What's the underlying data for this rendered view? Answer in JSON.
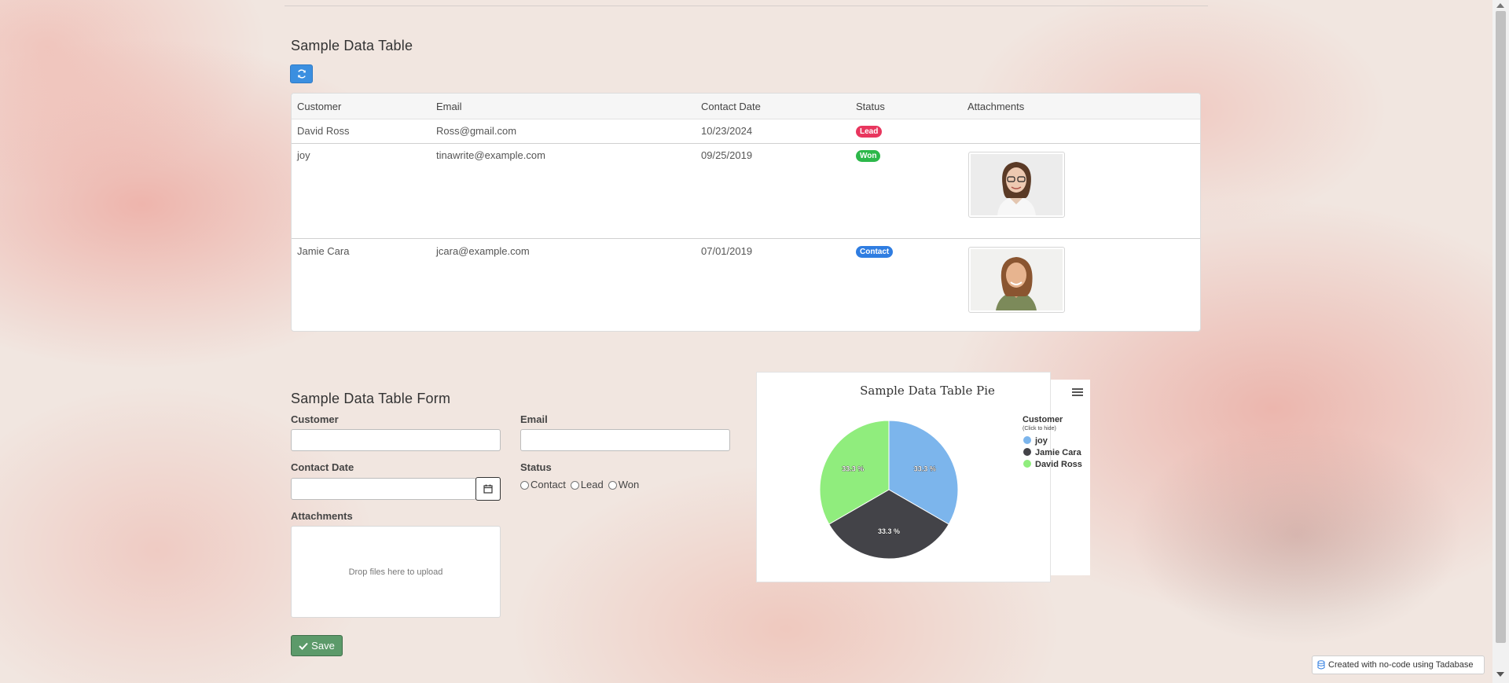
{
  "table_section": {
    "title": "Sample Data Table",
    "columns": [
      "Customer",
      "Email",
      "Contact Date",
      "Status",
      "Attachments"
    ],
    "rows": [
      {
        "customer": "David Ross",
        "email": "Ross@gmail.com",
        "date": "10/23/2024",
        "status": "Lead",
        "status_color": "#e8365e",
        "has_attachment": false
      },
      {
        "customer": "joy",
        "email": "tinawrite@example.com",
        "date": "09/25/2019",
        "status": "Won",
        "status_color": "#2db84a",
        "has_attachment": true
      },
      {
        "customer": "Jamie Cara",
        "email": "jcara@example.com",
        "date": "07/01/2019",
        "status": "Contact",
        "status_color": "#2f7de1",
        "has_attachment": true
      }
    ],
    "refresh_icon": "refresh-icon"
  },
  "form": {
    "title": "Sample Data Table Form",
    "customer_label": "Customer",
    "email_label": "Email",
    "contact_date_label": "Contact Date",
    "status_label": "Status",
    "status_options": [
      "Contact",
      "Lead",
      "Won"
    ],
    "attachments_label": "Attachments",
    "dropzone_text": "Drop files here to upload",
    "save_label": "Save",
    "save_color": "#5c9a6a"
  },
  "chart_data": {
    "type": "pie",
    "title": "Sample Data Table Pie",
    "legend_title": "Customer",
    "legend_subtitle": "(Click to hide)",
    "legend_position": "right",
    "slices": [
      {
        "name": "joy",
        "value": 33.3,
        "label": "33.3 %",
        "color": "#7cb5ec"
      },
      {
        "name": "Jamie Cara",
        "value": 33.3,
        "label": "33.3 %",
        "color": "#434348"
      },
      {
        "name": "David Ross",
        "value": 33.3,
        "label": "33.3 %",
        "color": "#90ed7d"
      }
    ]
  },
  "footer": {
    "badge_text": "Created with no-code using Tadabase"
  }
}
